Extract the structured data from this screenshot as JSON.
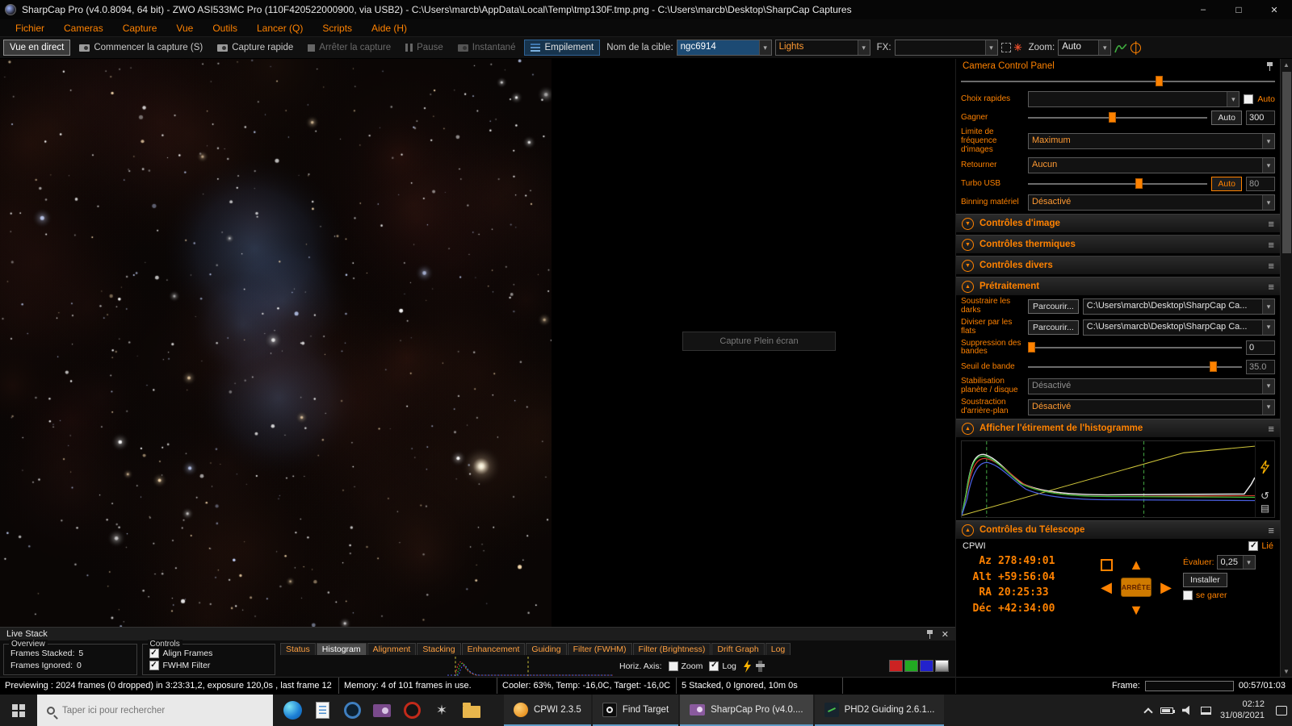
{
  "colors": {
    "accent": "#ff8200",
    "progress": "#22b222"
  },
  "titlebar": {
    "title": "SharpCap Pro (v4.0.8094, 64 bit) - ZWO ASI533MC Pro (110F420522000900, via USB2) - C:\\Users\\marcb\\AppData\\Local\\Temp\\tmp130F.tmp.png - C:\\Users\\marcb\\Desktop\\SharpCap Captures"
  },
  "menubar": {
    "items": [
      "Fichier",
      "Cameras",
      "Capture",
      "Vue",
      "Outils",
      "Lancer (Q)",
      "Scripts",
      "Aide (H)"
    ]
  },
  "toolbar": {
    "live_view": "Vue en direct",
    "start_capture": "Commencer la capture (S)",
    "quick_capture": "Capture rapide",
    "stop_capture": "Arrêter la capture",
    "pause": "Pause",
    "snapshot": "Instantané",
    "stack": "Empilement",
    "target_label": "Nom de la cible:",
    "target_value": "ngc6914",
    "frame_type_value": "Lights",
    "fx_label": "FX:",
    "fx_value": "",
    "zoom_label": "Zoom:",
    "zoom_value": "Auto"
  },
  "viewport": {
    "ghost_button": "Capture Plein écran"
  },
  "camera_panel": {
    "title": "Camera Control Panel",
    "quick_picks_label": "Choix rapides",
    "quick_picks_value": "",
    "auto_label": "Auto",
    "gain_label": "Gagner",
    "gain_auto": "Auto",
    "gain_value": "300",
    "fps_label": "Limite de fréquence d'images",
    "fps_value": "Maximum",
    "flip_label": "Retourner",
    "flip_value": "Aucun",
    "usb_label": "Turbo USB",
    "usb_auto": "Auto",
    "usb_value": "80",
    "binning_label": "Binning matériel",
    "binning_value": "Désactivé",
    "sections": {
      "image": "Contrôles d'image",
      "thermal": "Contrôles thermiques",
      "misc": "Contrôles divers",
      "preprocessing": "Prétraitement",
      "histogram": "Afficher l'étirement de l'histogramme",
      "telescope": "Contrôles du Télescope"
    },
    "preprocessing": {
      "darks_label": "Soustraire les darks",
      "darks_browse": "Parcourir...",
      "darks_path": "C:\\Users\\marcb\\Desktop\\SharpCap Ca...",
      "flats_label": "Diviser par les flats",
      "flats_browse": "Parcourir...",
      "flats_path": "C:\\Users\\marcb\\Desktop\\SharpCap Ca...",
      "banding_label": "Suppression des bandes",
      "banding_value": "0",
      "band_threshold_label": "Seuil de bande",
      "band_threshold_value": "35.0",
      "stabilization_label": "Stabilisation planète / disque",
      "stabilization_value": "Désactivé",
      "background_label": "Soustraction d'arrière-plan",
      "background_value": "Désactivé"
    }
  },
  "telescope": {
    "driver": "CPWI",
    "linked_label": "Lié",
    "az_label": "Az",
    "az_value": "278:49:01",
    "alt_label": "Alt",
    "alt_value": "+59:56:04",
    "ra_label": "RA",
    "ra_value": "20:25:33",
    "dec_label": "Déc",
    "dec_value": "+42:34:00",
    "stop_label": "ARRÊTE",
    "rate_label": "Évaluer:",
    "rate_value": "0,25",
    "setup_label": "Installer",
    "park_label": "se garer"
  },
  "live_stack": {
    "title": "Live Stack",
    "tabs": [
      "Status",
      "Histogram",
      "Alignment",
      "Stacking",
      "Enhancement",
      "Guiding",
      "Filter (FWHM)",
      "Filter (Brightness)",
      "Drift Graph",
      "Log"
    ],
    "active_tab": "Histogram",
    "overview_label": "Overview",
    "frames_stacked_label": "Frames Stacked:",
    "frames_stacked_value": "5",
    "frames_ignored_label": "Frames Ignored:",
    "frames_ignored_value": "0",
    "controls_label": "Controls",
    "align_frames_label": "Align Frames",
    "fwhm_filter_label": "FWHM Filter",
    "horiz_axis_label": "Horiz. Axis:",
    "zoom_label": "Zoom",
    "log_label": "Log"
  },
  "status_bar": {
    "previewing": "Previewing : 2024 frames (0 dropped) in 3:23:31,2, exposure 120,0s , last frame 12",
    "memory": "Memory: 4 of 101 frames in use.",
    "cooler": "Cooler: 63%, Temp: -16,0C, Target: -16,0C",
    "stacked": "5 Stacked, 0 Ignored, 10m 0s",
    "frame_label": "Frame:",
    "frame_time": "00:57/01:03"
  },
  "taskbar": {
    "search_placeholder": "Taper ici pour rechercher",
    "apps": [
      "CPWI 2.3.5",
      "Find Target",
      "SharpCap Pro (v4.0....",
      "PHD2 Guiding 2.6.1..."
    ],
    "time": "02:12",
    "date": "31/08/2021"
  }
}
